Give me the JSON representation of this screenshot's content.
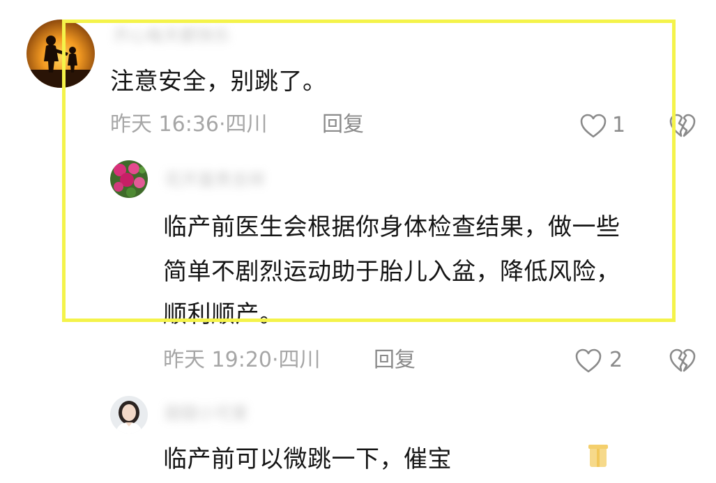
{
  "comments": [
    {
      "username": "开心每天都快乐",
      "text": "注意安全，别跳了。",
      "time": "昨天 16:36",
      "location": "四川",
      "reply_label": "回复",
      "likes": "1",
      "replies": [
        {
          "username": "花开富贵吉祥",
          "text_lines": [
            "临产前医生会根据你身体检查结果，做一些",
            "简单不剧烈运动助于胎儿入盆，降低风险，",
            "顺利顺产。"
          ],
          "time": "昨天 19:20",
          "location": "四川",
          "reply_label": "回复",
          "likes": "2"
        },
        {
          "username": "甜甜小可爱",
          "text": "临产前可以微跳一下，催宝",
          "time": "",
          "location": "",
          "reply_label": "",
          "likes": ""
        }
      ]
    }
  ],
  "colors": {
    "highlight": "#f4f34a",
    "meta_text": "#a6a6a6",
    "comment_text": "#151515"
  },
  "icons": [
    "heart-outline-icon",
    "broken-heart-icon",
    "gift-icon"
  ]
}
